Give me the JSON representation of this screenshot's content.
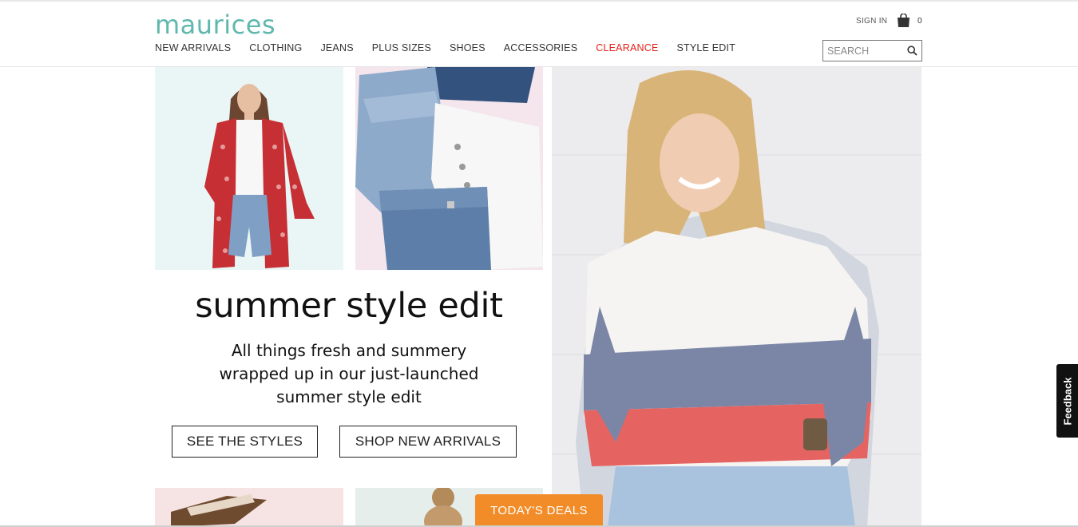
{
  "brand": {
    "logo_text": "maurices",
    "accent": "#5fb8ad"
  },
  "nav": {
    "items": [
      {
        "label": "NEW ARRIVALS"
      },
      {
        "label": "CLOTHING"
      },
      {
        "label": "JEANS"
      },
      {
        "label": "PLUS SIZES"
      },
      {
        "label": "SHOES"
      },
      {
        "label": "ACCESSORIES"
      },
      {
        "label": "CLEARANCE",
        "color": "#e2231a"
      },
      {
        "label": "STYLE EDIT"
      }
    ]
  },
  "account": {
    "sign_in": "SIGN IN",
    "bag_count": "0",
    "bag_icon": "shopping-bag-icon"
  },
  "search": {
    "placeholder": "SEARCH",
    "icon": "search-icon"
  },
  "hero": {
    "title": "summer style edit",
    "subtitle_lines": [
      "All things fresh and summery",
      "wrapped up in our just-launched",
      "summer style edit"
    ],
    "buttons": {
      "see_styles": "SEE THE STYLES",
      "shop_new": "SHOP NEW ARRIVALS"
    }
  },
  "widgets": {
    "deals": "TODAY'S DEALS",
    "deals_color": "#f28c28",
    "feedback": "Feedback"
  }
}
